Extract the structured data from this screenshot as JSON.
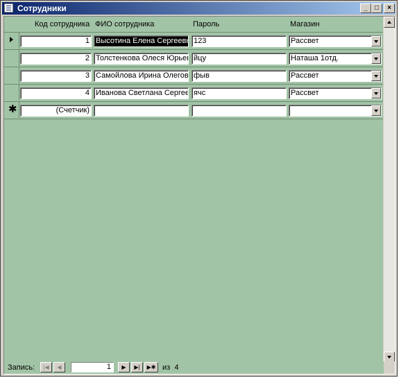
{
  "window": {
    "title": "Сотрудники"
  },
  "columns": [
    {
      "label": "Код сотрудника"
    },
    {
      "label": "ФИО сотрудника"
    },
    {
      "label": "Пароль"
    },
    {
      "label": "Магазин"
    }
  ],
  "rows": [
    {
      "id": "1",
      "name": "Высотина Елена Сергеевн",
      "password": "123",
      "store": "Рассвет",
      "current": true
    },
    {
      "id": "2",
      "name": "Толстенкова Олеся Юрьев",
      "password": "йцу",
      "store": "Наташа 1отд.",
      "current": false
    },
    {
      "id": "3",
      "name": "Самойлова Ирина Олегов",
      "password": "фыв",
      "store": "Рассвет",
      "current": false
    },
    {
      "id": "4",
      "name": "Иванова Светлана Сергее",
      "password": "ячс",
      "store": "Рассвет",
      "current": false
    }
  ],
  "new_row": {
    "id": "(Счетчик)",
    "name": "",
    "password": "",
    "store": ""
  },
  "navigation": {
    "label": "Запись:",
    "current_record": "1",
    "of_label": "из",
    "total": "4"
  },
  "icons": {
    "current_record": "triangle-right",
    "new_record": "asterisk",
    "first": "first-record",
    "prev": "previous-record",
    "next": "next-record",
    "last": "last-record",
    "add": "new-record"
  }
}
